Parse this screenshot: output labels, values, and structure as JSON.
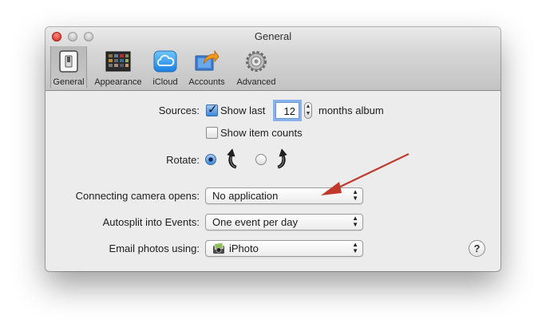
{
  "window": {
    "title": "General"
  },
  "toolbar": {
    "items": [
      {
        "label": "General",
        "icon": "general-switch-icon",
        "selected": true
      },
      {
        "label": "Appearance",
        "icon": "appearance-icon",
        "selected": false
      },
      {
        "label": "iCloud",
        "icon": "icloud-icon",
        "selected": false
      },
      {
        "label": "Accounts",
        "icon": "accounts-icon",
        "selected": false
      },
      {
        "label": "Advanced",
        "icon": "gear-icon",
        "selected": false
      }
    ]
  },
  "sources": {
    "label": "Sources:",
    "show_last_label": "Show last",
    "show_last_checked": true,
    "months_value": "12",
    "months_suffix": "months album",
    "item_counts_label": "Show item counts",
    "item_counts_checked": false
  },
  "rotate": {
    "label": "Rotate:",
    "options": [
      "counterclockwise",
      "clockwise"
    ],
    "selected": "counterclockwise"
  },
  "camera": {
    "label": "Connecting camera opens:",
    "value": "No application"
  },
  "autosplit": {
    "label": "Autosplit into Events:",
    "value": "One event per day"
  },
  "email": {
    "label": "Email photos using:",
    "value": "iPhoto",
    "icon": "iphoto-icon"
  },
  "help": {
    "label": "?"
  },
  "annotation": {
    "arrow_color": "#c0392b"
  }
}
